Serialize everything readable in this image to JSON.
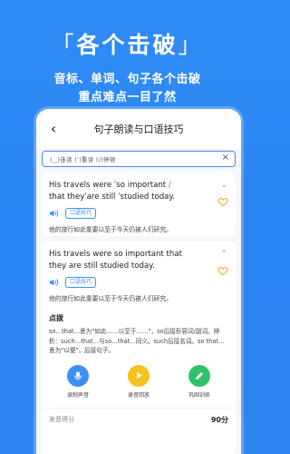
{
  "hero": {
    "title": "各个击破",
    "bracket_open": "「",
    "bracket_close": "」",
    "line1": "音标、单词、句子各个击破",
    "line2": "重点难点一目了然"
  },
  "topbar": {
    "title": "句子朗读与口语技巧"
  },
  "filter": {
    "text": "(‿)连读 (ˈ)重读 (/)停顿"
  },
  "card1": {
    "sentence_part1": "His travels were ˈso important",
    "slash": "/",
    "sentence_part2": "that theyˈare still ˈstudied today.",
    "tag": "口语技巧",
    "translation": "他的旅行如此重要以至于今天仍被人们研究。"
  },
  "card2": {
    "sentence": "His travels were so important that they are still studied today.",
    "tag": "口语技巧",
    "translation": "他的旅行如此重要以至于今天仍被人们研究。",
    "section_title": "点拨",
    "note": "so…that…意为\"如此……以至于……\"，so后接形容词/副词。辨析：such…that…与so…that…同义。such后接名词。so that…意为\"以便\"，后接句子。",
    "actions": [
      {
        "label": "录制声音",
        "icon": "microphone-icon"
      },
      {
        "label": "录音回放",
        "icon": "play-icon"
      },
      {
        "label": "巩固训练",
        "icon": "pencil-icon"
      }
    ],
    "score_label": "发音得分",
    "score_value": "90分"
  },
  "colors": {
    "background": "#2f8cf6",
    "accent": "#3d8ff5",
    "heart": "#f6a623",
    "record": "#3d8ff5",
    "playback": "#f6c21b",
    "practice": "#30c26a"
  }
}
